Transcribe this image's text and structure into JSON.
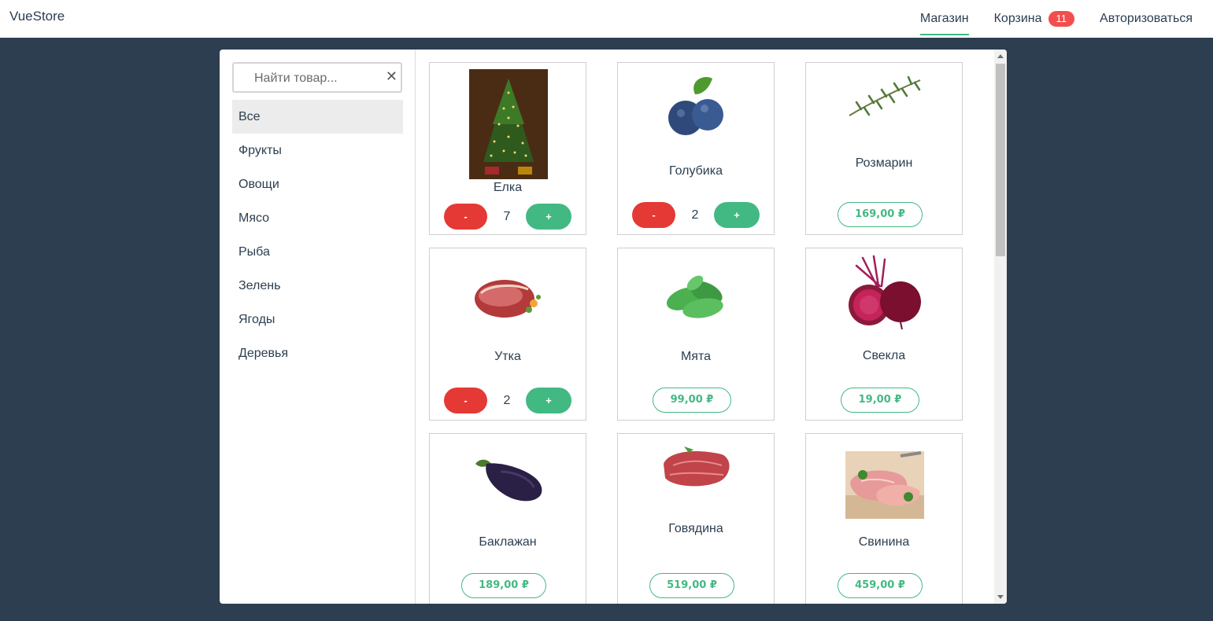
{
  "brand": "VueStore",
  "nav": {
    "shop": "Магазин",
    "cart": "Корзина",
    "cart_count": "11",
    "login": "Авторизоваться"
  },
  "search": {
    "placeholder": "Найти товар...",
    "clear": "✕"
  },
  "categories": [
    "Все",
    "Фрукты",
    "Овощи",
    "Мясо",
    "Рыба",
    "Зелень",
    "Ягоды",
    "Деревья"
  ],
  "products": [
    {
      "name": "Елка",
      "qty": "7",
      "minus": "-",
      "plus": "+",
      "icon": "christmas-tree-image"
    },
    {
      "name": "Голубика",
      "qty": "2",
      "minus": "-",
      "plus": "+",
      "icon": "blueberry-image"
    },
    {
      "name": "Розмарин",
      "price": "169,00 ₽",
      "icon": "rosemary-image"
    },
    {
      "name": "Утка",
      "qty": "2",
      "minus": "-",
      "plus": "+",
      "icon": "duck-meat-image"
    },
    {
      "name": "Мята",
      "price": "99,00 ₽",
      "icon": "mint-image"
    },
    {
      "name": "Свекла",
      "price": "19,00 ₽",
      "icon": "beet-image"
    },
    {
      "name": "Баклажан",
      "price": "189,00 ₽",
      "icon": "eggplant-image"
    },
    {
      "name": "Говядина",
      "price": "519,00 ₽",
      "icon": "beef-image"
    },
    {
      "name": "Свинина",
      "price": "459,00 ₽",
      "icon": "pork-image"
    }
  ],
  "colors": {
    "accent": "#42b983",
    "danger": "#e53935",
    "background": "#2c3e50",
    "badge": "#f24e4e"
  }
}
